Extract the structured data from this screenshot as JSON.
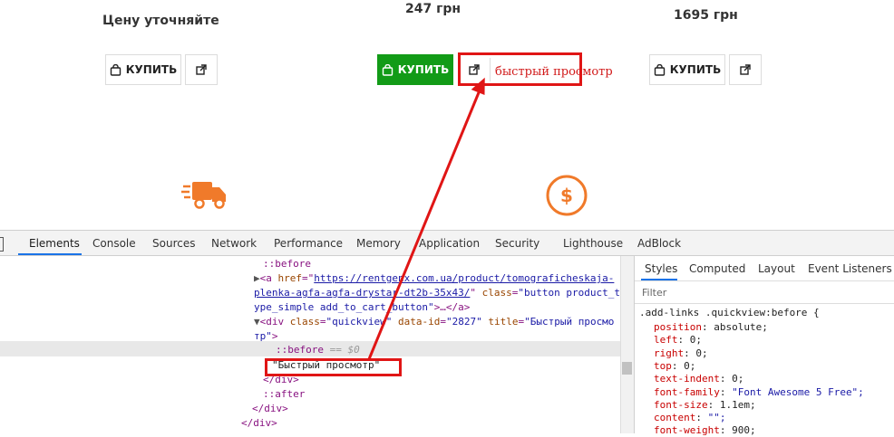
{
  "products": {
    "price_1": "Цену уточняйте",
    "price_2": "247 грн",
    "price_3": "1695 грн",
    "buy_label": "КУПИТЬ",
    "quickview_label": "быстрый просмотр"
  },
  "colors": {
    "accent_orange": "#f07a2a",
    "buy_green": "#129b17",
    "annotation_red": "#e01515"
  },
  "devtools": {
    "tabs": [
      "Elements",
      "Console",
      "Sources",
      "Network",
      "Performance",
      "Memory",
      "Application",
      "Security",
      "Lighthouse",
      "AdBlock"
    ],
    "active_tab": "Elements",
    "elements": {
      "line1": "::before",
      "line2_tag": "<a ",
      "line2_attr": "href",
      "line2_href": "https://rentgenx.com.ua/product/tomograficheskaja-",
      "line3_href": "plenka-agfa-agfa-drystar-dt2b-35x43/",
      "line3_class_attr": "class",
      "line3_class_val": "\"button product_t",
      "line4_class_val": "ype_simple add_to_cart_button\"",
      "line4_rest": ">…</a>",
      "line5_tag": "<div ",
      "line5_class_attr": "class",
      "line5_class_val": "\"quickview\"",
      "line5_dataid_attr": "data-id",
      "line5_dataid_val": "\"2827\"",
      "line5_title_attr": "title",
      "line5_title_val": "\"Быстрый просмо",
      "line6_title_val": "тр\"",
      "line6_close": ">",
      "line7": "::before",
      "line7_eq": "== $0",
      "line8": "\"Быстрый просмотр\"",
      "line9": "</div>",
      "line10": "::after",
      "line11": "</div>",
      "line12": "</div>"
    },
    "styles": {
      "tabs": [
        "Styles",
        "Computed",
        "Layout",
        "Event Listeners"
      ],
      "active_tab": "Styles",
      "filter_placeholder": "Filter",
      "selector": ".add-links .quickview:before {",
      "rules": [
        {
          "prop": "position",
          "val": "absolute;"
        },
        {
          "prop": "left",
          "val": "0;"
        },
        {
          "prop": "right",
          "val": "0;"
        },
        {
          "prop": "top",
          "val": "0;"
        },
        {
          "prop": "text-indent",
          "val": "0;"
        },
        {
          "prop": "font-family",
          "val": "\"Font Awesome 5 Free\";"
        },
        {
          "prop": "font-size",
          "val": "1.1em;"
        },
        {
          "prop": "content",
          "val": "\"\";"
        },
        {
          "prop": "font-weight",
          "val": "900;"
        }
      ]
    }
  }
}
